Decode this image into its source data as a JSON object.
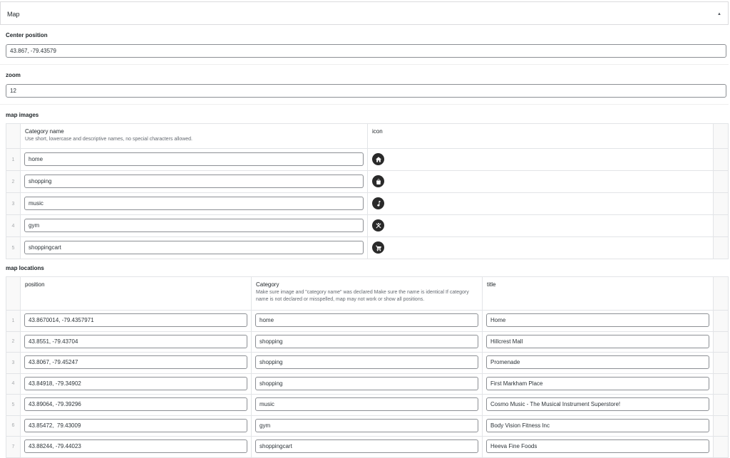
{
  "panel": {
    "title": "Map",
    "collapse_icon": "▲"
  },
  "center_position": {
    "label": "Center position",
    "value": "43.867, -79.43579"
  },
  "zoom": {
    "label": "zoom",
    "value": "12"
  },
  "map_images": {
    "label": "map images",
    "headers": {
      "category": "Category name",
      "category_instructions": "Use short, lowercase and descriptive names, no special characters allowed.",
      "icon": "icon"
    },
    "rows": [
      {
        "order": "1",
        "category": "home",
        "icon": "home-icon"
      },
      {
        "order": "2",
        "category": "shopping",
        "icon": "shopping-bag-icon"
      },
      {
        "order": "3",
        "category": "music",
        "icon": "music-note-icon"
      },
      {
        "order": "4",
        "category": "gym",
        "icon": "fitness-icon"
      },
      {
        "order": "5",
        "category": "shoppingcart",
        "icon": "shopping-cart-icon"
      }
    ]
  },
  "map_locations": {
    "label": "map locations",
    "headers": {
      "position": "position",
      "category": "Category",
      "category_instructions": "Make sure image and \"category name\" was declared Make sure the name is identical If category name is not declared or misspelled, map may not work or show all positions.",
      "title": "title"
    },
    "rows": [
      {
        "order": "1",
        "position": "43.8670014, -79.4357971",
        "category": "home",
        "title": "Home"
      },
      {
        "order": "2",
        "position": "43.8551, -79.43704",
        "category": "shopping",
        "title": "Hillcrest Mall"
      },
      {
        "order": "3",
        "position": "43.8067, -79.45247",
        "category": "shopping",
        "title": "Promenade"
      },
      {
        "order": "4",
        "position": "43.84918, -79.34902",
        "category": "shopping",
        "title": "First Markham Place"
      },
      {
        "order": "5",
        "position": "43.89064, -79.39296",
        "category": "music",
        "title": "Cosmo Music - The Musical Instrument Superstore!"
      },
      {
        "order": "6",
        "position": "43.85472,  79.43009",
        "category": "gym",
        "title": "Body Vision Fitness Inc"
      },
      {
        "order": "7",
        "position": "43.88244, -79.44023",
        "category": "shoppingcart",
        "title": "Heeva Fine Foods"
      }
    ]
  }
}
